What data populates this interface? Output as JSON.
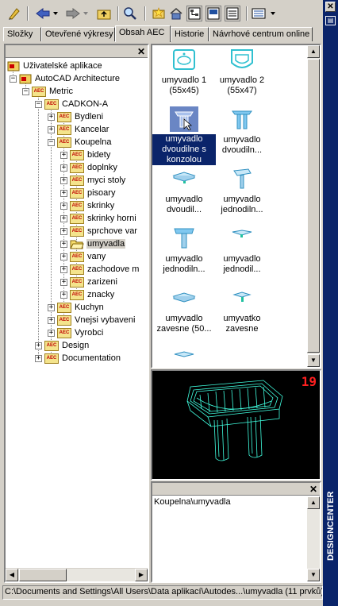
{
  "toolbar": {
    "buttons": [
      {
        "name": "load-icon"
      },
      {
        "name": "back-icon"
      },
      {
        "name": "forward-icon"
      },
      {
        "name": "up-folder-icon"
      },
      {
        "name": "search-icon"
      },
      {
        "name": "favorites-icon"
      },
      {
        "name": "home-icon"
      },
      {
        "name": "tree-toggle-icon"
      },
      {
        "name": "preview-icon"
      },
      {
        "name": "description-icon"
      },
      {
        "name": "views-icon"
      }
    ]
  },
  "tabs": [
    "Složky",
    "Otevřené výkresy",
    "Obsah AEC",
    "Historie",
    "Návrhové centrum online"
  ],
  "active_tab": "Obsah AEC",
  "tree": {
    "root": "Uživatelské aplikace",
    "app": "AutoCAD Architecture",
    "metric": "Metric",
    "cadkon": "CADKON-A",
    "bydleni": "Bydleni",
    "kancelar": "Kancelar",
    "koupelna": "Koupelna",
    "koupelna_children": [
      "bidety",
      "doplnky",
      "myci stoly",
      "pisoary",
      "skrinky",
      "skrinky horni",
      "sprchove var",
      "umyvadla",
      "vany",
      "zachodove m",
      "zarizeni",
      "znacky"
    ],
    "selected": "umyvadla",
    "kuchyn": "Kuchyn",
    "vnejsi": "Vnejsi vybaveni",
    "vyrobci": "Vyrobci",
    "design": "Design",
    "documentation": "Documentation"
  },
  "items": [
    {
      "label": "umyvadlo 1 (55x45)",
      "icon": "basin-icon"
    },
    {
      "label": "umyvadlo 2 (55x47)",
      "icon": "basin-icon"
    },
    {
      "label": "umyvadlo dvoudilne s konzolou",
      "icon": "pedestal-basin-icon",
      "selected": true
    },
    {
      "label": "umyvadlo dvoudiln...",
      "icon": "pedestal-basin-icon"
    },
    {
      "label": "umyvadlo dvoudil...",
      "icon": "basin-icon"
    },
    {
      "label": "umyvadlo jednodiln...",
      "icon": "pedestal-basin-icon"
    },
    {
      "label": "umyvadlo jednodiln...",
      "icon": "pedestal-basin-icon"
    },
    {
      "label": "umyvadlo jednodil...",
      "icon": "basin-icon"
    },
    {
      "label": "umyvadlo zavesne (50...",
      "icon": "basin-icon"
    },
    {
      "label": "umyvatko zavesne",
      "icon": "basin-icon"
    }
  ],
  "preview_number": "19",
  "description": "Koupelna\\umyvadla",
  "status": "C:\\Documents and Settings\\All Users\\Data aplikací\\Autodes...\\umyvadla (11 prvků)",
  "side_title": "DESIGNCENTER",
  "colors": {
    "accent": "#0a246a",
    "preview_bg": "#000000",
    "wireframe": "#40ffe0",
    "preview_number": "#ff2020"
  }
}
